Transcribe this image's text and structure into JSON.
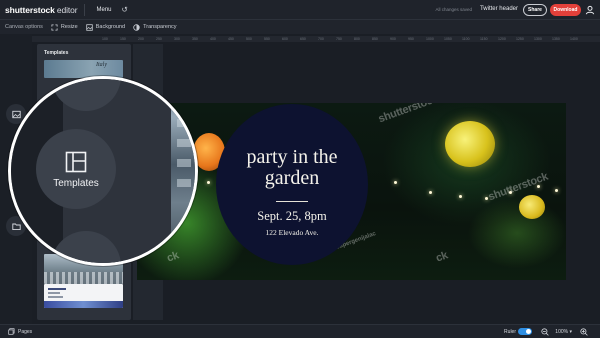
{
  "app": {
    "logo": "shutterstock",
    "logo_suffix": "editor",
    "menu_label": "Menu",
    "undo_glyph": "↺"
  },
  "header": {
    "saved_status": "All changes saved",
    "doc_title": "Twitter header",
    "share_label": "Share",
    "download_label": "Download",
    "user_icon": "user-icon"
  },
  "toolbar": {
    "canvas_options_label": "Canvas options",
    "resize_label": "Resize",
    "background_label": "Background",
    "transparency_label": "Transparency"
  },
  "ruler_ticks": [
    "100",
    "150",
    "200",
    "250",
    "300",
    "350",
    "400",
    "450",
    "500",
    "550",
    "600",
    "650",
    "700",
    "750",
    "800",
    "850",
    "900",
    "950",
    "1000",
    "1050",
    "1100",
    "1150",
    "1200",
    "1250",
    "1300",
    "1350",
    "1400"
  ],
  "panel": {
    "title": "Templates",
    "thumb1_text": "Italy"
  },
  "magnifier": {
    "templates_label": "Templates",
    "icon": "templates-icon"
  },
  "design": {
    "line1": "party in the",
    "line2": "garden",
    "date": "Sept. 25, 8pm",
    "address": "122 Elevado Ave.",
    "watermark": "shutterstock",
    "credit": "supergenijalac",
    "watermark_partial": "ck",
    "lantern_colors": {
      "yellow": "#e4cf2a",
      "orange": "#ec8a2a",
      "circle": "#0d1230"
    }
  },
  "bottom": {
    "pages_label": "Pages",
    "ruler_label": "Ruler",
    "ruler_on": true,
    "zoom_label": "100%",
    "zoom_caret": "▾"
  },
  "colors": {
    "accent": "#e3403a",
    "toggle": "#2f8fe3",
    "bg": "#1a1e25"
  }
}
